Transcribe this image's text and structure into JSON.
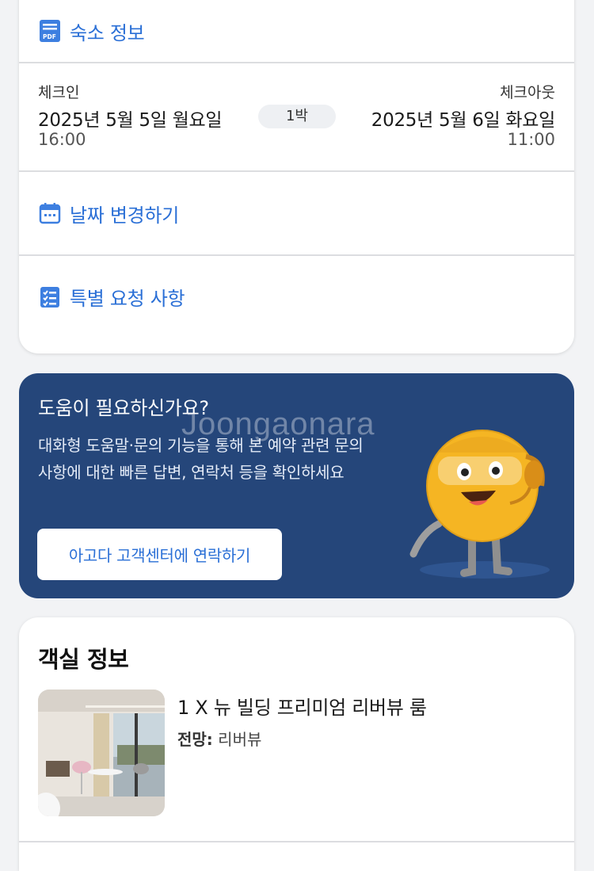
{
  "booking": {
    "property_info_label": "숙소 정보",
    "checkin_label": "체크인",
    "checkin_date": "2025년 5월 5일 월요일",
    "checkin_time": "16:00",
    "nights": "1박",
    "checkout_label": "체크아웃",
    "checkout_date": "2025년 5월 6일 화요일",
    "checkout_time": "11:00",
    "change_dates_label": "날짜 변경하기",
    "special_requests_label": "특별 요청 사항"
  },
  "help": {
    "title": "도움이 필요하신가요?",
    "description": "대화형 도움말·문의 기능을 통해 본 예약 관련 문의 사항에 대한 빠른 답변, 연락처 등을 확인하세요",
    "button_label": "아고다 고객센터에 연락하기",
    "watermark": "Joongaonara"
  },
  "room": {
    "heading": "객실 정보",
    "name": "1 X 뉴 빌딩 프리미엄 리버뷰 룸",
    "view_label": "전망:",
    "view_value": "리버뷰"
  },
  "icons": {
    "property_info": "pdf-document-icon",
    "change_dates": "calendar-icon",
    "special_requests": "checklist-icon"
  },
  "colors": {
    "link_blue": "#2a6fd6",
    "help_bg": "#25467a",
    "page_bg": "#f2f3f5"
  }
}
